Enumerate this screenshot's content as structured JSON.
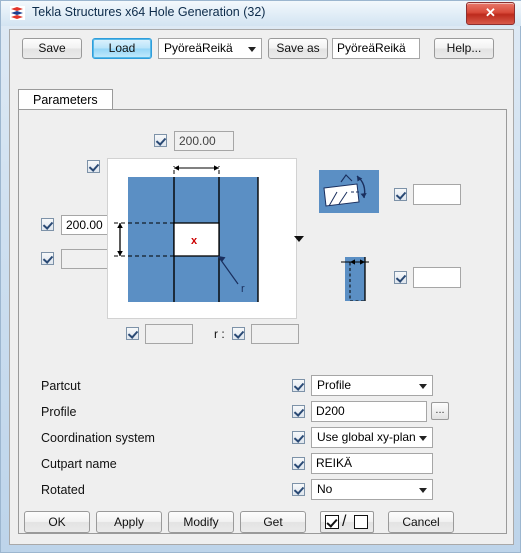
{
  "window": {
    "title": "Tekla Structures x64  Hole Generation (32)",
    "icon": "tekla-logo-icon",
    "close_label": "✕"
  },
  "toolbar": {
    "save_label": "Save",
    "load_label": "Load",
    "preset_selected": "PyöreäReikä",
    "save_as_label": "Save as",
    "save_as_value": "PyöreäReikä",
    "help_label": "Help..."
  },
  "tabs": [
    {
      "label": "Parameters",
      "active": true
    }
  ],
  "diagram_section": {
    "top_field": {
      "checked": true,
      "value": "200.00",
      "readonly": true
    },
    "panel_checkbox": {
      "checked": true
    },
    "left_field_1": {
      "checked": true,
      "value": "200.00",
      "readonly": false
    },
    "left_field_2": {
      "checked": true,
      "value": "",
      "readonly": true
    },
    "bottom_field_1": {
      "checked": true,
      "value": "",
      "readonly": true
    },
    "bottom_field_2": {
      "checked": true,
      "value": "",
      "readonly": true,
      "prefix": "r :"
    },
    "radius_label": "r",
    "center_marker": "x",
    "expand_arrow": "chevron-down-icon",
    "colors": {
      "plate_fill": "#5b8fc4",
      "hole_fill": "#ffffff",
      "marker": "#cc0000",
      "line": "#000000"
    }
  },
  "side_icons": [
    {
      "name": "rotation-icon",
      "field": {
        "checked": true,
        "value": ""
      }
    },
    {
      "name": "edge-distance-icon",
      "field": {
        "checked": true,
        "value": ""
      }
    }
  ],
  "properties": [
    {
      "label": "Partcut",
      "checked": true,
      "type": "combo",
      "value": "Profile"
    },
    {
      "label": "Profile",
      "checked": true,
      "type": "text-browse",
      "value": "D200",
      "browse_label": "..."
    },
    {
      "label": "Coordination system",
      "checked": true,
      "type": "combo",
      "value": "Use global xy-plan"
    },
    {
      "label": "Cutpart name",
      "checked": true,
      "type": "text",
      "value": "REIKÄ"
    },
    {
      "label": "Rotated",
      "checked": true,
      "type": "combo",
      "value": "No"
    }
  ],
  "bottom_buttons": {
    "ok": "OK",
    "apply": "Apply",
    "modify": "Modify",
    "get": "Get",
    "toggle": {
      "checked_box": true,
      "separator": "/",
      "unchecked_box": false
    },
    "cancel": "Cancel"
  }
}
